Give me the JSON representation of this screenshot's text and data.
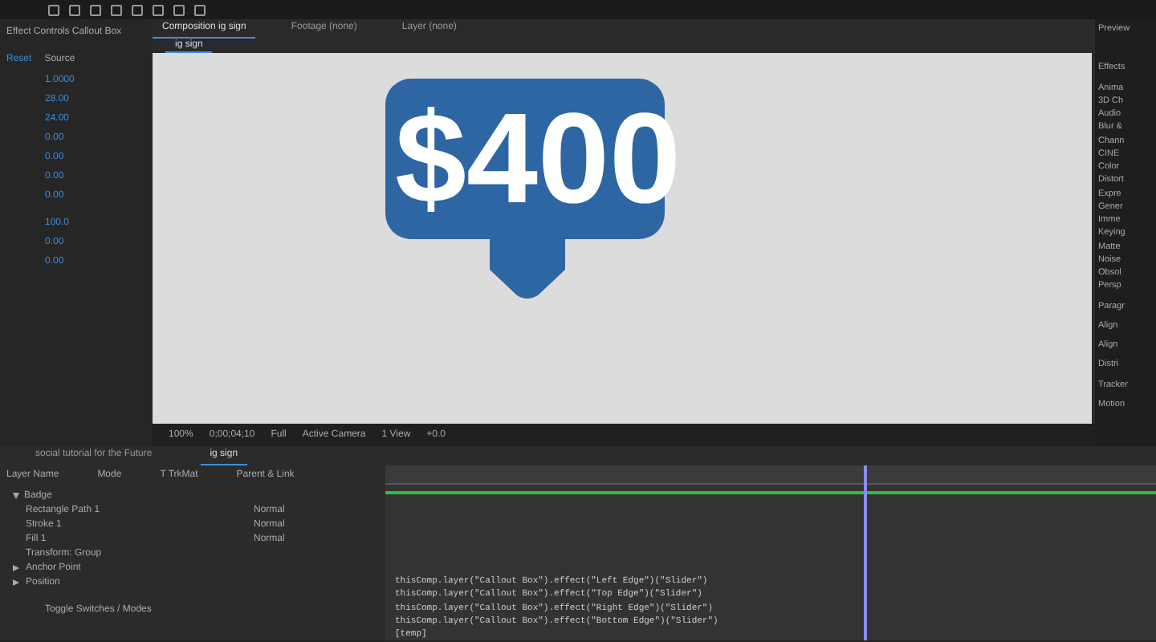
{
  "effect_controls": {
    "title": "Effect Controls Callout Box",
    "reset": "Reset",
    "values": [
      "1.0000",
      "28.00",
      "24.00",
      "0.00",
      "0.00",
      "0.00",
      "0.00",
      "100.0",
      "0.00",
      "0.00"
    ],
    "source": "Source"
  },
  "viewer": {
    "tabs": [
      {
        "label": "Composition ig sign",
        "selected": true
      },
      {
        "label": "Footage (none)",
        "selected": false
      },
      {
        "label": "Layer (none)",
        "selected": false
      }
    ],
    "subtab": "ig sign",
    "badge_text": "$400",
    "bar": [
      "100%",
      "0;00;04;10",
      "Full",
      "Active Camera",
      "1 View",
      "+0.0"
    ]
  },
  "timeline": {
    "tabs": [
      {
        "label": "social tutorial for the Future",
        "selected": false
      },
      {
        "label": "ig sign",
        "selected": true
      }
    ],
    "columns": [
      "Layer Name",
      "Mode",
      "T TrkMat",
      "Parent & Link"
    ],
    "layers": [
      {
        "name": "Badge",
        "expanded": true,
        "children": [
          {
            "name": "Rectangle Path 1",
            "mode": "Normal"
          },
          {
            "name": "Stroke 1",
            "mode": "Normal"
          },
          {
            "name": "Fill 1",
            "mode": "Normal"
          },
          {
            "name": "Transform: Group"
          }
        ]
      },
      {
        "name": "Anchor Point",
        "expanded": false
      },
      {
        "name": "Position",
        "expanded": false
      }
    ],
    "expression": [
      "thisComp.layer(\"Callout Box\").effect(\"Left Edge\")(\"Slider\")",
      "thisComp.layer(\"Callout Box\").effect(\"Top Edge\")(\"Slider\")",
      "thisComp.layer(\"Callout Box\").effect(\"Right Edge\")(\"Slider\")",
      "thisComp.layer(\"Callout Box\").effect(\"Bottom Edge\")(\"Slider\")",
      "[temp]"
    ],
    "footer": "Toggle Switches / Modes"
  },
  "right_panel": {
    "preview": "Preview",
    "effects_title": "Effects",
    "effects": [
      "Anima",
      "3D Ch",
      "Audio",
      "Blur &",
      "Chann",
      "CINE",
      "Color",
      "Distort",
      "Expre",
      "Gener",
      "Imme",
      "Keying",
      "Matte",
      "Noise",
      "Obsol",
      "Persp"
    ],
    "paragraph": "Paragr",
    "align": "Align",
    "align_to": "Align",
    "distribute": "Distri",
    "tracker": "Tracker",
    "motion": "Motion"
  }
}
